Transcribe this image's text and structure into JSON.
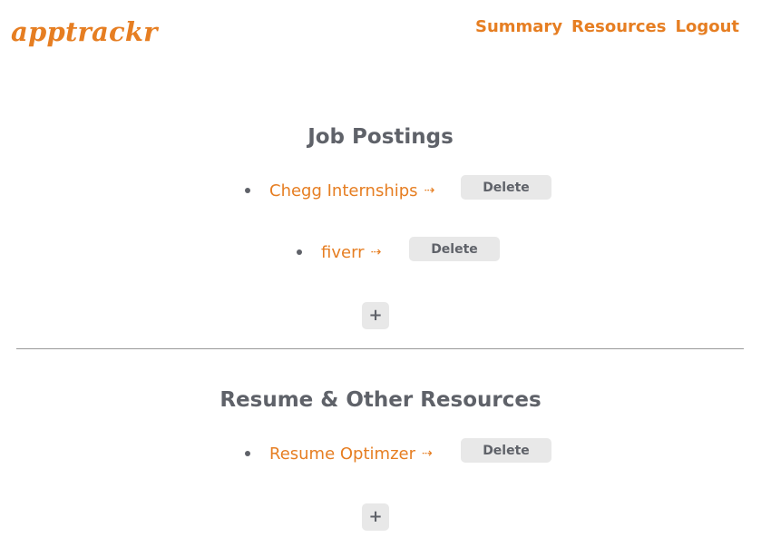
{
  "header": {
    "logo": "apptrackr",
    "nav": [
      "Summary",
      "Resources",
      "Logout"
    ]
  },
  "job_postings": {
    "title": "Job Postings",
    "items": [
      {
        "label": "Chegg Internships",
        "arrow": "⇢",
        "delete_label": "Delete"
      },
      {
        "label": "fiverr",
        "arrow": "⇢",
        "delete_label": "Delete"
      }
    ],
    "add_label": "+"
  },
  "resources": {
    "title": "Resume & Other Resources",
    "items": [
      {
        "label": "Resume Optimzer",
        "arrow": "⇢",
        "delete_label": "Delete"
      }
    ],
    "add_label": "+"
  },
  "colors": {
    "accent": "#e67e22",
    "text": "#5f6269",
    "button_bg": "#e8e8e8",
    "divider": "#999999"
  }
}
